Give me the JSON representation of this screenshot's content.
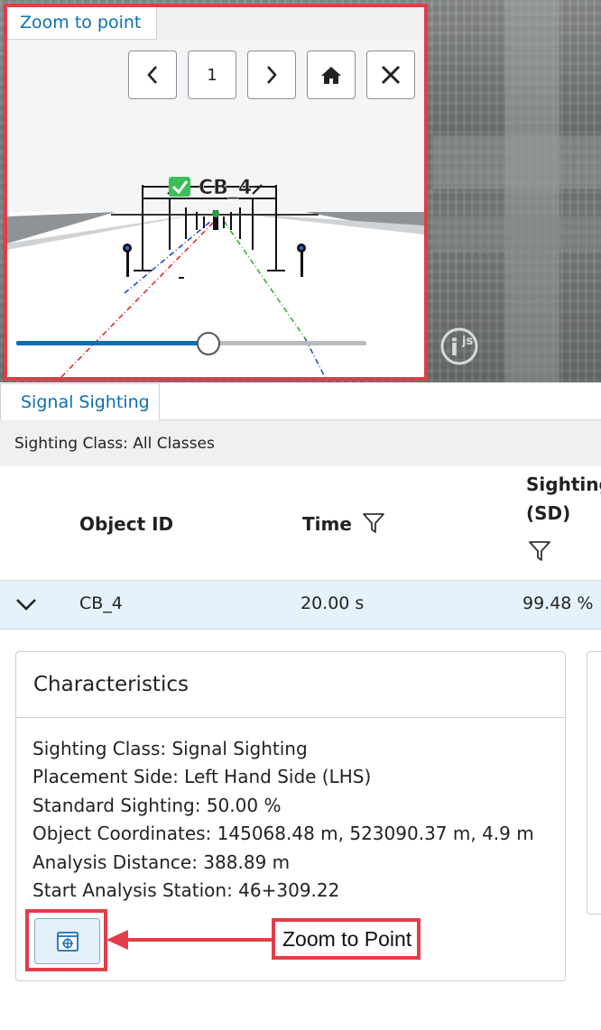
{
  "zoom_panel": {
    "tab_label": "Zoom to point",
    "page_number": "1",
    "scene_label": "CB_4",
    "slider_percent": 55
  },
  "signal_tab": {
    "label": "Signal Sighting"
  },
  "class_filter": {
    "text": "Sighting Class: All Classes"
  },
  "table": {
    "columns": [
      "Object ID",
      "Time",
      "Sighting",
      "(SD)"
    ],
    "rows": [
      {
        "object_id": "CB_4",
        "time": "20.00 s",
        "sighting": "99.48 %"
      }
    ]
  },
  "characteristics": {
    "title": "Characteristics",
    "lines": [
      "Sighting Class: Signal Sighting",
      "Placement Side: Left Hand Side (LHS)",
      "Standard Sighting: 50.00 %",
      "Object Coordinates: 145068.48 m, 523090.37 m, 4.9 m",
      "Analysis Distance: 388.89 m",
      "Start Analysis Station: 46+309.22"
    ]
  },
  "callout": {
    "label": "Zoom to Point"
  },
  "colors": {
    "highlight": "#e23d48",
    "accent": "#0a6fb4",
    "row_selected": "#e6f2fb"
  },
  "icons": {
    "prev": "chevron-left-icon",
    "next": "chevron-right-icon",
    "home": "home-icon",
    "close": "close-icon",
    "filter": "filter-icon",
    "expand": "chevron-down-icon",
    "zoom": "zoom-to-point-icon"
  }
}
